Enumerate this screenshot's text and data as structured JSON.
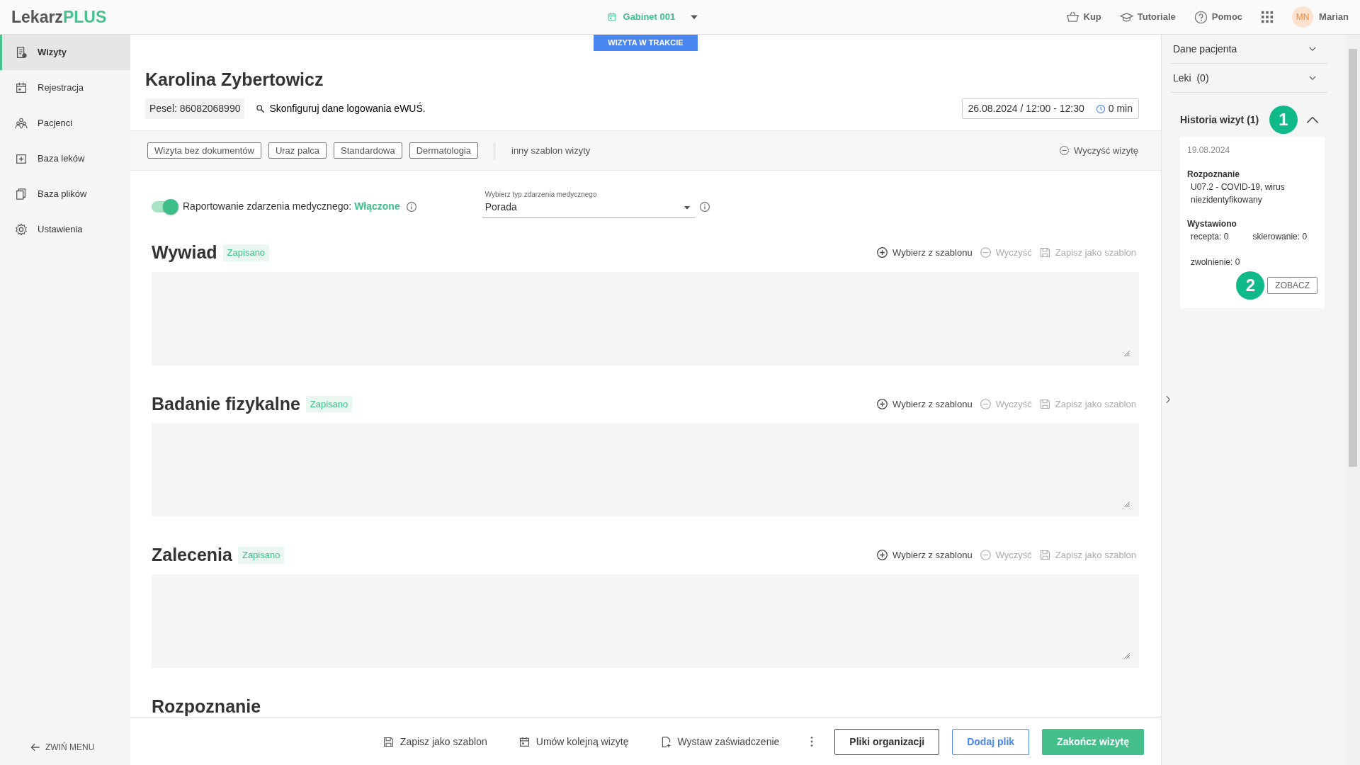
{
  "topbar": {
    "logo": {
      "first": "Lekarz",
      "second": "PLUS"
    },
    "room": "Gabinet 001",
    "actions": [
      {
        "label": "Kup"
      },
      {
        "label": "Tutoriale"
      },
      {
        "label": "Pomoc"
      }
    ],
    "user": {
      "initials": "MN",
      "name": "Marian"
    }
  },
  "sidebar": {
    "items": [
      {
        "label": "Wizyty",
        "selected": true
      },
      {
        "label": "Rejestracja",
        "selected": false
      },
      {
        "label": "Pacjenci",
        "selected": false
      },
      {
        "label": "Baza leków",
        "selected": false
      },
      {
        "label": "Baza plików",
        "selected": false
      },
      {
        "label": "Ustawienia",
        "selected": false
      }
    ],
    "collapse": "ZWIŃ MENU"
  },
  "status_badge": "WIZYTA W TRAKCIE",
  "patient": {
    "name": "Karolina Zybertowicz",
    "pesel": "Pesel: 86082068990",
    "ewus": "Skonfiguruj dane logowania eWUŚ.",
    "datetime": "26.08.2024 / 12:00 - 12:30",
    "duration": "0 min"
  },
  "templates": {
    "items": [
      "Wizyta bez dokumentów",
      "Uraz palca",
      "Standardowa",
      "Dermatologia"
    ],
    "other": "inny szablon wizyty",
    "clear": "Wyczyść wizytę"
  },
  "reporting": {
    "label": "Raportowanie zdarzenia medycznego:",
    "value": "Włączone",
    "on": true
  },
  "event_type": {
    "label": "Wybierz typ zdarzenia medycznego",
    "value": "Porada"
  },
  "sections": [
    {
      "title": "Wywiad",
      "status": "Zapisano",
      "actions": [
        {
          "label": "Wybierz z szablonu",
          "disabled": false
        },
        {
          "label": "Wyczyść",
          "disabled": true
        },
        {
          "label": "Zapisz jako szablon",
          "disabled": true
        }
      ]
    },
    {
      "title": "Badanie fizykalne",
      "status": "Zapisano",
      "actions": [
        {
          "label": "Wybierz z szablonu",
          "disabled": false
        },
        {
          "label": "Wyczyść",
          "disabled": true
        },
        {
          "label": "Zapisz jako szablon",
          "disabled": true
        }
      ]
    },
    {
      "title": "Zalecenia",
      "status": "Zapisano",
      "actions": [
        {
          "label": "Wybierz z szablonu",
          "disabled": false
        },
        {
          "label": "Wyczyść",
          "disabled": true
        },
        {
          "label": "Zapisz jako szablon",
          "disabled": true
        }
      ]
    },
    {
      "title": "Rozpoznanie"
    }
  ],
  "bottom_bar": {
    "actions": [
      {
        "label": "Zapisz jako szablon"
      },
      {
        "label": "Umów kolejną wizytę"
      },
      {
        "label": "Wystaw zaświadczenie"
      }
    ],
    "buttons": [
      {
        "label": "Pliki organizacji",
        "kind": "outline"
      },
      {
        "label": "Dodaj plik",
        "kind": "outline-blue"
      },
      {
        "label": "Zakończ wizytę",
        "kind": "primary"
      }
    ]
  },
  "right_panel": {
    "accordions": [
      {
        "title": "Dane pacjenta",
        "expanded": false
      },
      {
        "title": "Leki  (0)",
        "expanded": false
      }
    ],
    "history": {
      "title": "Historia wizyt (1)",
      "expanded": true,
      "step": "1",
      "date": "19.08.2024",
      "diagnosis_label": "Rozpoznanie",
      "diagnosis": "U07.2 - COVID-19, wirus niezidentyfikowany",
      "issued_label": "Wystawiono",
      "counts": [
        "recepta: 0",
        "skierowanie: 0",
        "zwolnienie: 0"
      ],
      "view_step": "2",
      "view": "ZOBACZ"
    }
  }
}
